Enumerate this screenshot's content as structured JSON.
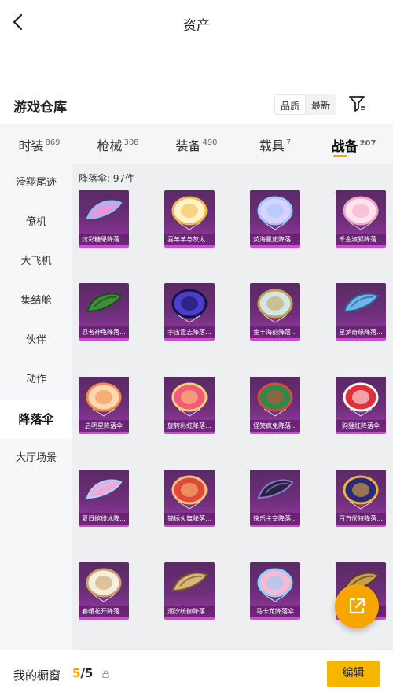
{
  "header": {
    "title": "资产"
  },
  "section": {
    "title": "游戏仓库",
    "sort_quality": "品质",
    "sort_latest": "最新"
  },
  "tabs": [
    {
      "label": "时装",
      "count": "869",
      "active": false
    },
    {
      "label": "枪械",
      "count": "308",
      "active": false
    },
    {
      "label": "装备",
      "count": "490",
      "active": false
    },
    {
      "label": "载具",
      "count": "7",
      "active": false
    },
    {
      "label": "战备",
      "count": "207",
      "active": true
    }
  ],
  "sidebar": {
    "items": [
      {
        "label": "滑翔尾迹",
        "active": false
      },
      {
        "label": "僚机",
        "active": false
      },
      {
        "label": "大飞机",
        "active": false
      },
      {
        "label": "集结舱",
        "active": false
      },
      {
        "label": "伙伴",
        "active": false
      },
      {
        "label": "动作",
        "active": false
      },
      {
        "label": "降落伞",
        "active": true
      },
      {
        "label": "大厅场景",
        "active": false
      }
    ]
  },
  "content": {
    "count_label": "降落伞: 97件",
    "items": [
      {
        "name": "炫彩糖果降落...",
        "icon": "parachute-canopy",
        "colors": [
          "#ff8fd8",
          "#6ad0ff"
        ]
      },
      {
        "name": "喜羊羊与灰太...",
        "icon": "parachute-round",
        "colors": [
          "#fff3c8",
          "#f2b84a"
        ]
      },
      {
        "name": "荧海星旅降落...",
        "icon": "parachute-round",
        "colors": [
          "#d9d2ff",
          "#9fc6ff"
        ]
      },
      {
        "name": "千金淑狐降落...",
        "icon": "parachute-round",
        "colors": [
          "#ffe3ee",
          "#f3a7c4"
        ]
      },
      {
        "name": "忍者神龟降落...",
        "icon": "parachute-canopy",
        "colors": [
          "#3f8f3a",
          "#1d4a22"
        ]
      },
      {
        "name": "宇宙意志降落...",
        "icon": "parachute-round",
        "colors": [
          "#4b3fc9",
          "#16104a"
        ]
      },
      {
        "name": "金丰海韵降落...",
        "icon": "parachute-round",
        "colors": [
          "#cfe6ea",
          "#c9a04a"
        ]
      },
      {
        "name": "星梦奇缘降落...",
        "icon": "parachute-canopy",
        "colors": [
          "#6fb7e8",
          "#2f5f9a"
        ]
      },
      {
        "name": "启明星降落伞",
        "icon": "parachute-round",
        "colors": [
          "#ffd7b0",
          "#f08a4a"
        ]
      },
      {
        "name": "旋转彩虹降落...",
        "icon": "parachute-round",
        "colors": [
          "#f25a7a",
          "#f7d07a"
        ]
      },
      {
        "name": "怪笑疯兔降落...",
        "icon": "parachute-round",
        "colors": [
          "#2e8a4a",
          "#d94a3a"
        ]
      },
      {
        "name": "狗狸红降落伞",
        "icon": "parachute-round",
        "colors": [
          "#e0303a",
          "#ffffff"
        ]
      },
      {
        "name": "夏日缤纷冰降...",
        "icon": "parachute-canopy",
        "colors": [
          "#f4a6d6",
          "#a8d8ff"
        ]
      },
      {
        "name": "锦绣火舞降落...",
        "icon": "parachute-round",
        "colors": [
          "#e04a3a",
          "#f7c27a"
        ]
      },
      {
        "name": "快乐主宰降落...",
        "icon": "parachute-canopy",
        "colors": [
          "#2a2440",
          "#8a7ad8"
        ]
      },
      {
        "name": "百万伏特降落...",
        "icon": "parachute-round",
        "colors": [
          "#2b2a7a",
          "#f3b23a"
        ]
      },
      {
        "name": "春暖花开降落...",
        "icon": "parachute-round",
        "colors": [
          "#f4eedc",
          "#c9a06a"
        ]
      },
      {
        "name": "潮汐统御降落...",
        "icon": "parachute-canopy",
        "colors": [
          "#d8b87a",
          "#7a5a2a"
        ]
      },
      {
        "name": "马卡龙降落伞",
        "icon": "parachute-round",
        "colors": [
          "#ffb7d2",
          "#7fd6ff"
        ]
      },
      {
        "name": "",
        "icon": "parachute-canopy",
        "colors": [
          "#c9a04a",
          "#5a3a2a"
        ]
      }
    ]
  },
  "fab": {
    "icon": "share-out-icon"
  },
  "bottom": {
    "showcase_label": "我的橱窗",
    "showcase_current": "5",
    "showcase_sep_total": "/5",
    "edit_label": "编辑"
  }
}
